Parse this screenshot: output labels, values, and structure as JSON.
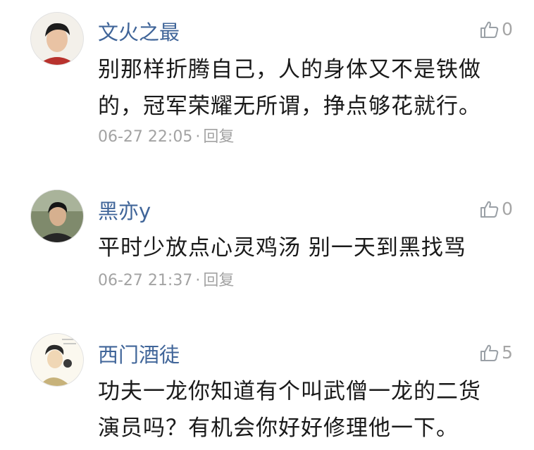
{
  "comments": [
    {
      "user": "文火之最",
      "likes": "0",
      "text_lines": [
        "别那样折腾自己，人的身体又不是铁做",
        "的，冠军荣耀无所谓，挣点够花就行。"
      ],
      "time": "06-27 22:05",
      "dot": "·",
      "reply": "回复"
    },
    {
      "user": "黑亦y",
      "likes": "0",
      "text_lines": [
        "平时少放点心灵鸡汤 别一天到黑找骂"
      ],
      "time": "06-27 21:37",
      "dot": "·",
      "reply": "回复"
    },
    {
      "user": "西门酒徒",
      "likes": "5",
      "text_lines": [
        "功夫一龙你知道有个叫武僧一龙的二货",
        "演员吗？有机会你好好修理他一下。"
      ]
    }
  ]
}
